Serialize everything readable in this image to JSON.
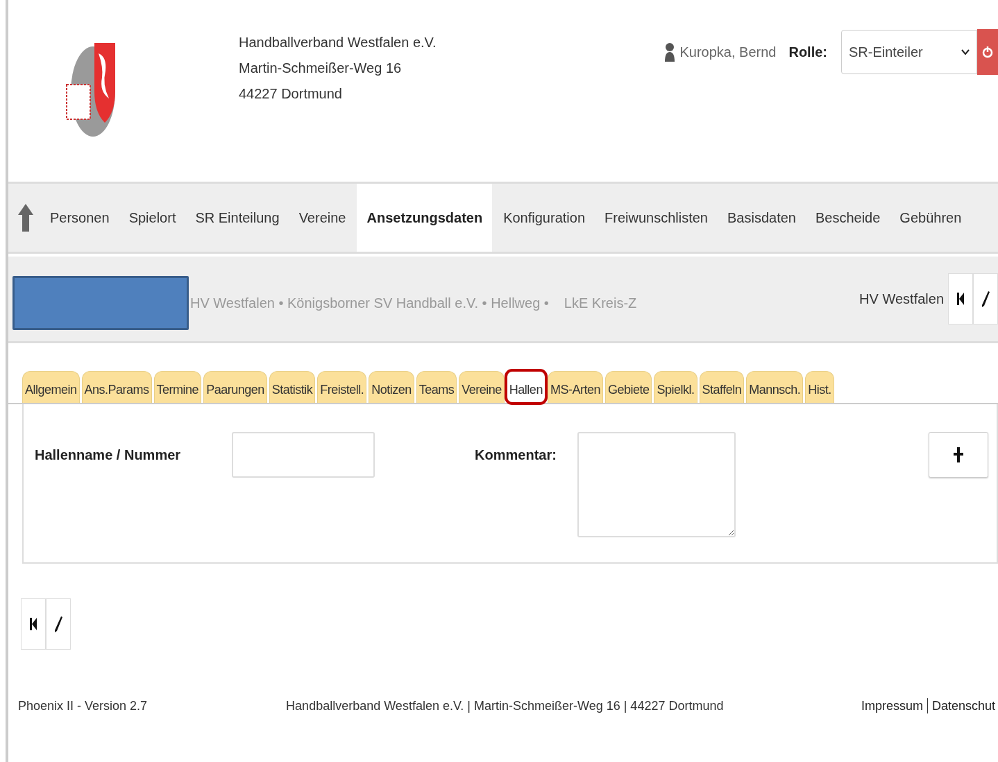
{
  "header": {
    "org_lines": [
      "Handballverband Westfalen e.V.",
      "Martin-Schmeißer-Weg 16",
      "44227 Dortmund"
    ],
    "user": "Kuropka, Bernd",
    "role_label": "Rolle:",
    "role_value": "SR-Einteiler"
  },
  "nav": {
    "items": [
      {
        "label": "Personen",
        "selected": false
      },
      {
        "label": "Spielort",
        "selected": false
      },
      {
        "label": "SR Einteilung",
        "selected": false
      },
      {
        "label": "Vereine",
        "selected": false
      },
      {
        "label": "Ansetzungsdaten",
        "selected": true
      },
      {
        "label": "Konfiguration",
        "selected": false
      },
      {
        "label": "Freiwunschlisten",
        "selected": false
      },
      {
        "label": "Basisdaten",
        "selected": false
      },
      {
        "label": "Bescheide",
        "selected": false
      },
      {
        "label": "Gebühren",
        "selected": false
      }
    ]
  },
  "breadcrumb": {
    "path": "HV Westfalen • Königsborner SV Handball e.V. • Hellweg •",
    "last": "LkE Kreis-Z",
    "context": "HV Westfalen"
  },
  "tabs": [
    {
      "label": "Allgemein",
      "selected": false,
      "highlighted": false
    },
    {
      "label": "Ans.Params",
      "selected": false,
      "highlighted": false
    },
    {
      "label": "Termine",
      "selected": false,
      "highlighted": false
    },
    {
      "label": "Paarungen",
      "selected": false,
      "highlighted": false
    },
    {
      "label": "Statistik",
      "selected": false,
      "highlighted": false
    },
    {
      "label": "Freistell.",
      "selected": false,
      "highlighted": false
    },
    {
      "label": "Notizen",
      "selected": false,
      "highlighted": false
    },
    {
      "label": "Teams",
      "selected": false,
      "highlighted": false
    },
    {
      "label": "Vereine",
      "selected": false,
      "highlighted": false
    },
    {
      "label": "Hallen",
      "selected": true,
      "highlighted": true
    },
    {
      "label": "MS-Arten",
      "selected": false,
      "highlighted": false
    },
    {
      "label": "Gebiete",
      "selected": false,
      "highlighted": false
    },
    {
      "label": "Spielkl.",
      "selected": false,
      "highlighted": false
    },
    {
      "label": "Staffeln",
      "selected": false,
      "highlighted": false
    },
    {
      "label": "Mannsch.",
      "selected": false,
      "highlighted": false
    },
    {
      "label": "Hist.",
      "selected": false,
      "highlighted": false
    }
  ],
  "form": {
    "name_label": "Hallenname / Nummer",
    "comment_label": "Kommentar:"
  },
  "footer": {
    "version": "Phoenix II - Version 2.7",
    "address": "Handballverband Westfalen e.V. | Martin-Schmeißer-Weg 16 | 44227 Dortmund",
    "links": [
      "Impressum",
      "Datenschut"
    ]
  }
}
